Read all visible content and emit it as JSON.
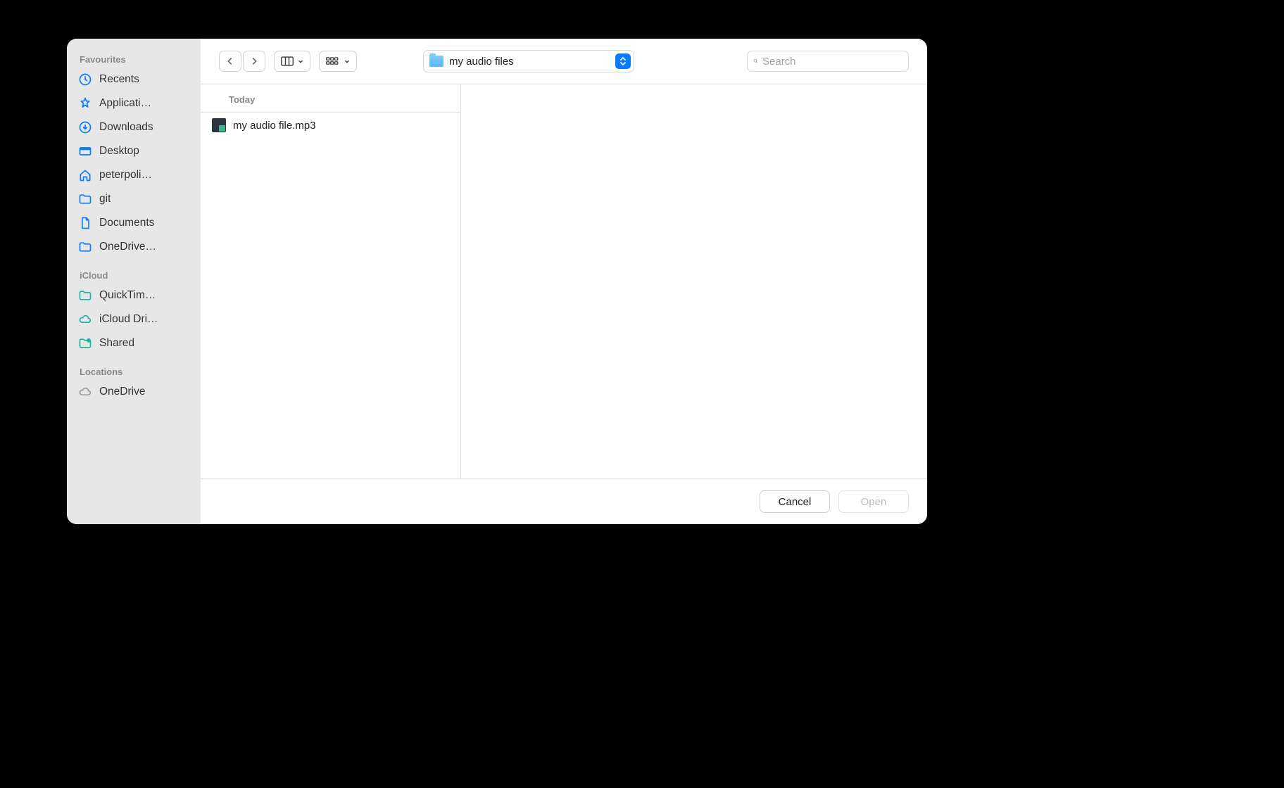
{
  "sidebar": {
    "sections": [
      {
        "title": "Favourites",
        "items": [
          {
            "icon": "clock",
            "label": "Recents",
            "color": "#0a7aff"
          },
          {
            "icon": "app",
            "label": "Applicati…",
            "color": "#0a7aff"
          },
          {
            "icon": "download",
            "label": "Downloads",
            "color": "#0a7aff"
          },
          {
            "icon": "desktop",
            "label": "Desktop",
            "color": "#0a7aff"
          },
          {
            "icon": "home",
            "label": "peterpoli…",
            "color": "#0a7aff"
          },
          {
            "icon": "folder",
            "label": "git",
            "color": "#0a7aff"
          },
          {
            "icon": "doc",
            "label": "Documents",
            "color": "#0a7aff"
          },
          {
            "icon": "folder",
            "label": "OneDrive…",
            "color": "#0a7aff"
          }
        ]
      },
      {
        "title": "iCloud",
        "items": [
          {
            "icon": "folder",
            "label": "QuickTim…",
            "color": "#14b8a6"
          },
          {
            "icon": "cloud",
            "label": "iCloud Dri…",
            "color": "#14b8a6"
          },
          {
            "icon": "folder-badge",
            "label": "Shared",
            "color": "#14b8a6"
          }
        ]
      },
      {
        "title": "Locations",
        "items": [
          {
            "icon": "cloud",
            "label": "OneDrive",
            "color": "#9a9a9a"
          }
        ]
      }
    ]
  },
  "toolbar": {
    "current_folder": "my audio files",
    "search_placeholder": "Search"
  },
  "content": {
    "column_header": "Today",
    "files": [
      {
        "name": "my audio file.mp3"
      }
    ]
  },
  "footer": {
    "cancel_label": "Cancel",
    "open_label": "Open"
  }
}
